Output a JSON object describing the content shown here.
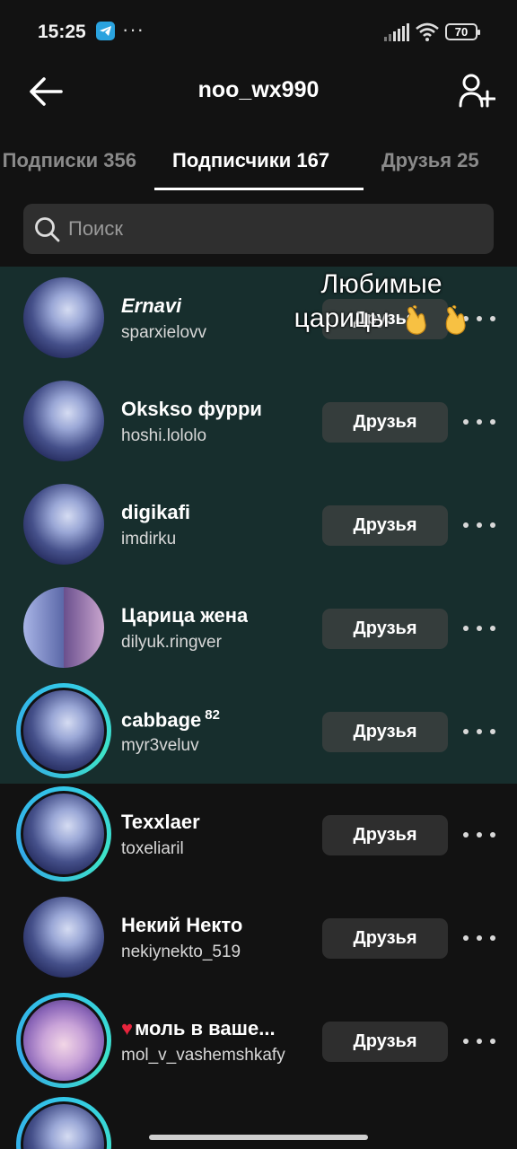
{
  "status_bar": {
    "time": "15:25",
    "more": "···",
    "battery": "70"
  },
  "header": {
    "title": "noo_wx990"
  },
  "tabs": [
    {
      "label": "Подписки 356"
    },
    {
      "label": "Подписчики 167"
    },
    {
      "label": "Друзья 25"
    }
  ],
  "search": {
    "placeholder": "Поиск"
  },
  "caption": {
    "line1": "Любимые",
    "line2": "царицы"
  },
  "friends_label": "Друзья",
  "rows": [
    {
      "name": "Ernavi",
      "username": "sparxielovv",
      "button": "Друзья"
    },
    {
      "name": "Okskso фурри",
      "username": "hoshi.lololo",
      "button": "Друзья"
    },
    {
      "name": "digikafi",
      "username": "imdirku",
      "button": "Друзья"
    },
    {
      "name": "Царица жена",
      "username": "dilyuk.ringver",
      "button": "Друзья"
    },
    {
      "name": "cabbage",
      "sup": "82",
      "username": "myr3veluv",
      "button": "Друзья"
    },
    {
      "name": "Texxlaer",
      "username": "toxeliaril",
      "button": "Друзья"
    },
    {
      "name": "Некий Некто",
      "username": "nekiynekto_519",
      "button": "Друзья"
    },
    {
      "name": "моль в ваше...",
      "username": "mol_v_vashemshkafy",
      "button": "Друзья"
    }
  ],
  "colors": {
    "background": "#121212",
    "highlight_band": "#172e2d",
    "button": "#353d3c",
    "story_ring": "#33c7e8",
    "heart": "#e8243c"
  },
  "icons": {
    "back": "arrow-left-icon",
    "add_user": "add-user-icon",
    "search": "search-icon",
    "more": "more-horizontal-icon"
  }
}
